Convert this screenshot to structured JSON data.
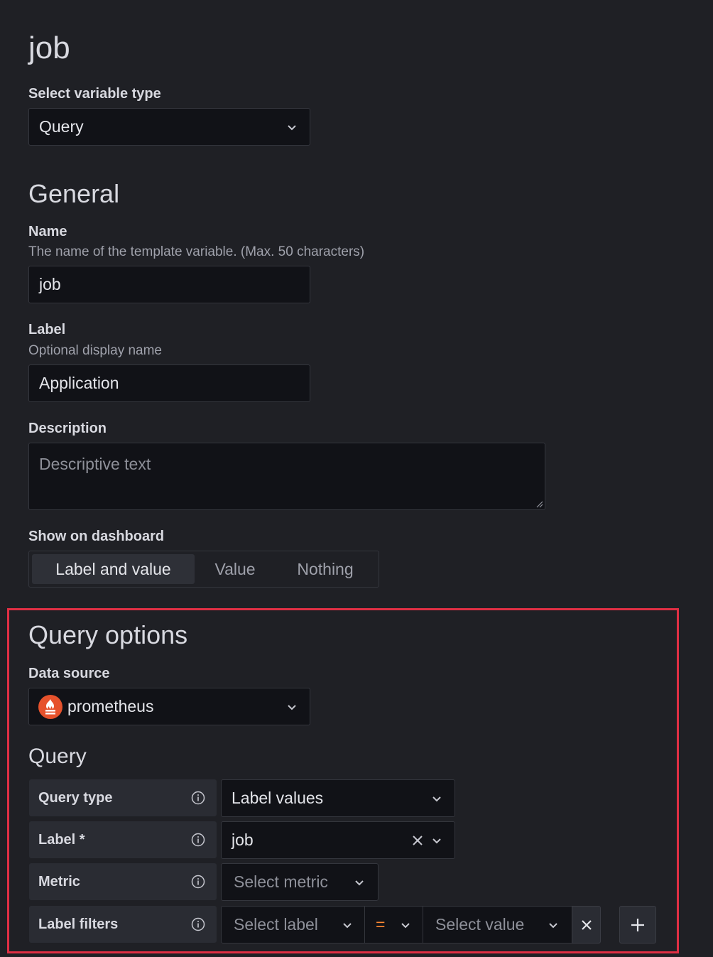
{
  "page": {
    "title": "job"
  },
  "variable_type": {
    "label": "Select variable type",
    "value": "Query"
  },
  "general": {
    "heading": "General",
    "name": {
      "label": "Name",
      "description": "The name of the template variable. (Max. 50 characters)",
      "value": "job"
    },
    "label": {
      "label": "Label",
      "description": "Optional display name",
      "value": "Application"
    },
    "description": {
      "label": "Description",
      "placeholder": "Descriptive text",
      "value": ""
    },
    "show_on_dashboard": {
      "label": "Show on dashboard",
      "options": [
        "Label and value",
        "Value",
        "Nothing"
      ],
      "selected": "Label and value"
    }
  },
  "query_options": {
    "heading": "Query options",
    "data_source": {
      "label": "Data source",
      "value": "prometheus",
      "icon": "prometheus-icon",
      "icon_color": "#e6522c"
    },
    "query": {
      "heading": "Query",
      "query_type": {
        "label": "Query type",
        "value": "Label values"
      },
      "label_field": {
        "label": "Label *",
        "value": "job"
      },
      "metric": {
        "label": "Metric",
        "placeholder": "Select metric"
      },
      "label_filters": {
        "label": "Label filters",
        "label_placeholder": "Select label",
        "operator": "=",
        "value_placeholder": "Select value"
      }
    }
  },
  "colors": {
    "highlight": "#e02f44",
    "operator": "#ff8833",
    "background": "#1f2025"
  }
}
